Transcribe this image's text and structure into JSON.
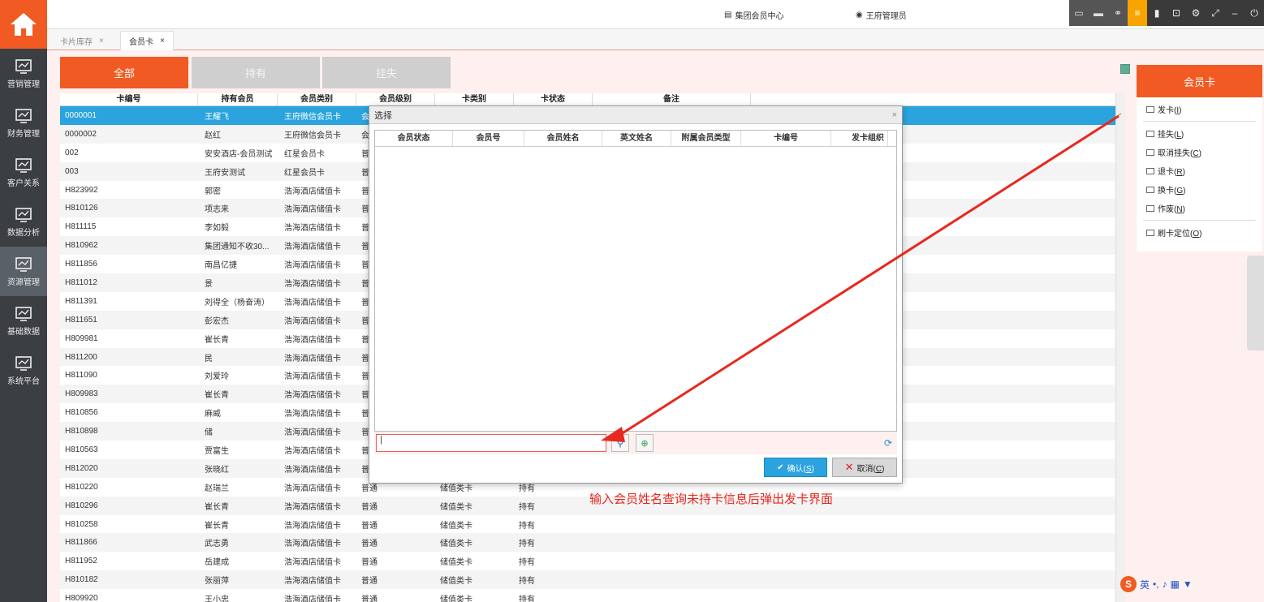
{
  "nav": {
    "items": [
      {
        "label": "营销管理",
        "icon": "chart-monitor-icon"
      },
      {
        "label": "财务管理",
        "icon": "register-icon"
      },
      {
        "label": "客户关系",
        "icon": "people-icon"
      },
      {
        "label": "数据分析",
        "icon": "analytics-icon"
      },
      {
        "label": "资源管理",
        "icon": "resource-icon"
      },
      {
        "label": "基础数据",
        "icon": "clipboard-icon"
      },
      {
        "label": "系统平台",
        "icon": "system-gear-icon"
      }
    ]
  },
  "topbar": {
    "center_label": "集团会员中心",
    "user_label": "王府管理员"
  },
  "tabs": [
    {
      "label": "卡片库存"
    },
    {
      "label": "会员卡"
    }
  ],
  "filters": {
    "all": "全部",
    "held": "持有",
    "lost": "挂失"
  },
  "grid": {
    "headers": [
      "卡编号",
      "持有会员",
      "会员类别",
      "会员级别",
      "卡类别",
      "卡状态",
      "备注"
    ],
    "rows": [
      [
        "0000001",
        "王耀飞",
        "王府微信会员卡",
        "会",
        "",
        "",
        ""
      ],
      [
        "0000002",
        "赵红",
        "王府微信会员卡",
        "会",
        "",
        "",
        ""
      ],
      [
        "002",
        "安安酒店-会员测试",
        "红星会员卡",
        "普",
        "",
        "",
        ""
      ],
      [
        "003",
        "王府安测试",
        "红星会员卡",
        "普",
        "",
        "",
        ""
      ],
      [
        "H823992",
        "郭密",
        "浩海酒店储值卡",
        "普",
        "",
        "",
        ""
      ],
      [
        "H810126",
        "项志来",
        "浩海酒店储值卡",
        "普",
        "",
        "",
        ""
      ],
      [
        "H811115",
        "李如毅",
        "浩海酒店储值卡",
        "普",
        "",
        "",
        ""
      ],
      [
        "H810962",
        "集团通知不收30...",
        "浩海酒店储值卡",
        "普",
        "",
        "",
        ""
      ],
      [
        "H811856",
        "南昌亿捷",
        "浩海酒店储值卡",
        "普",
        "",
        "",
        ""
      ],
      [
        "H811012",
        "景",
        "浩海酒店储值卡",
        "普",
        "",
        "",
        ""
      ],
      [
        "H811391",
        "刘得全（杨奋涛）",
        "浩海酒店储值卡",
        "普",
        "",
        "",
        ""
      ],
      [
        "H811651",
        "彭宏杰",
        "浩海酒店储值卡",
        "普",
        "",
        "",
        ""
      ],
      [
        "H809981",
        "崔长青",
        "浩海酒店储值卡",
        "普",
        "",
        "",
        ""
      ],
      [
        "H811200",
        "民",
        "浩海酒店储值卡",
        "普",
        "",
        "",
        ""
      ],
      [
        "H811090",
        "刘爱玲",
        "浩海酒店储值卡",
        "普",
        "",
        "",
        ""
      ],
      [
        "H809983",
        "崔长青",
        "浩海酒店储值卡",
        "普",
        "",
        "",
        ""
      ],
      [
        "H810856",
        "麻威",
        "浩海酒店储值卡",
        "普",
        "",
        "",
        ""
      ],
      [
        "H810898",
        "储",
        "浩海酒店储值卡",
        "普",
        "",
        "",
        ""
      ],
      [
        "H810563",
        "贾富生",
        "浩海酒店储值卡",
        "普",
        "",
        "",
        ""
      ],
      [
        "H812020",
        "张晓红",
        "浩海酒店储值卡",
        "普",
        "",
        "",
        ""
      ],
      [
        "H810220",
        "赵瑞兰",
        "浩海酒店储值卡",
        "普通",
        "储值类卡",
        "持有",
        ""
      ],
      [
        "H810296",
        "崔长青",
        "浩海酒店储值卡",
        "普通",
        "储值类卡",
        "持有",
        ""
      ],
      [
        "H810258",
        "崔长青",
        "浩海酒店储值卡",
        "普通",
        "储值类卡",
        "持有",
        ""
      ],
      [
        "H811866",
        "武志勇",
        "浩海酒店储值卡",
        "普通",
        "储值类卡",
        "持有",
        ""
      ],
      [
        "H811952",
        "岳建成",
        "浩海酒店储值卡",
        "普通",
        "储值类卡",
        "持有",
        ""
      ],
      [
        "H810182",
        "张丽萍",
        "浩海酒店储值卡",
        "普通",
        "储值类卡",
        "持有",
        ""
      ],
      [
        "H809920",
        "王小忠",
        "浩海酒店储值卡",
        "普通",
        "储值类卡",
        "持有",
        ""
      ]
    ]
  },
  "right_panel": {
    "title": "会员卡",
    "items": [
      {
        "label": "发卡",
        "key": "I"
      },
      {
        "label": "挂失",
        "key": "L"
      },
      {
        "label": "取消挂失",
        "key": "C"
      },
      {
        "label": "退卡",
        "key": "R"
      },
      {
        "label": "换卡",
        "key": "G"
      },
      {
        "label": "作废",
        "key": "N"
      },
      {
        "label": "刷卡定位",
        "key": "O"
      }
    ]
  },
  "dialog": {
    "title": "选择",
    "close": "×",
    "headers": [
      "会员状态",
      "会员号",
      "会员姓名",
      "英文姓名",
      "附属会员类型",
      "卡编号",
      "发卡组织"
    ],
    "search_value": "|",
    "ok_label": "确认",
    "ok_key": "S",
    "cancel_label": "取消",
    "cancel_key": "C"
  },
  "annotation": "输入会员姓名查询未持卡信息后弹出发卡界面",
  "ime": {
    "logo": "S",
    "lang": "英"
  },
  "colors": {
    "accent": "#f15a22",
    "selected_row": "#2aa3df",
    "annotation": "#e8281e"
  }
}
